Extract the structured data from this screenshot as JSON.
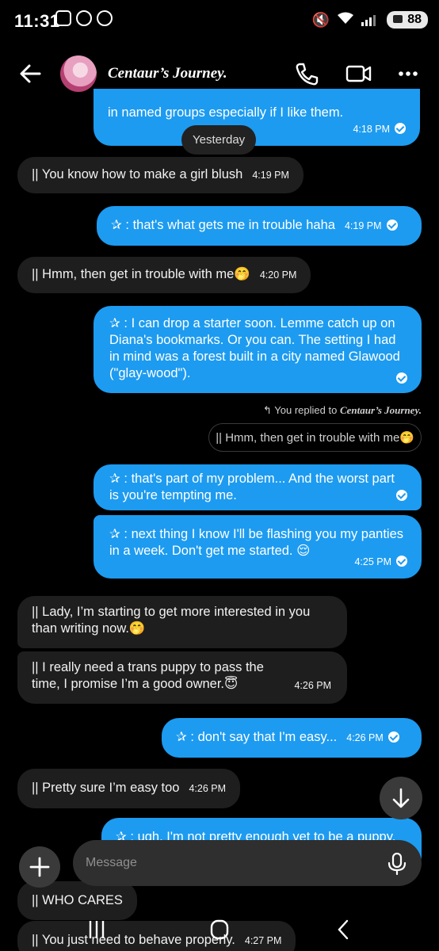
{
  "status": {
    "time": "11:31",
    "battery": "88",
    "signal_label": "6"
  },
  "header": {
    "title": "Centaur’s Journey."
  },
  "date_pill": "Yesterday",
  "messages": [
    {
      "dir": "out",
      "text": "in named groups especially if I like them.",
      "time": "4:18 PM"
    },
    {
      "dir": "in",
      "text": "|| You know how to make a girl blush",
      "time": "4:19 PM"
    },
    {
      "dir": "out",
      "text": "✰ : that's what gets me in trouble haha",
      "time": "4:19 PM"
    },
    {
      "dir": "in",
      "text": "|| Hmm, then get in trouble with me🤭",
      "time": "4:20 PM"
    },
    {
      "dir": "out",
      "text": "✰ : I can drop a starter soon. Lemme catch up on Diana's bookmarks. Or you can. The setting I had in mind was a forest built in a city named Glawood (\"glay-wood\").",
      "time": ""
    },
    {
      "dir": "out",
      "text": "✰ : that's part of my problem... And the worst part is you're tempting me.",
      "time": ""
    },
    {
      "dir": "out",
      "text": "✰ : next thing I know I'll be flashing you my panties in a week. Don't get me started. 😌",
      "time": "4:25 PM"
    },
    {
      "dir": "in",
      "text": "|| Lady, I’m starting to get more interested in you than writing now.🤭",
      "time": ""
    },
    {
      "dir": "in",
      "text": "|| I really need a trans puppy to pass the time, I promise I’m a good owner.😇",
      "time": "4:26 PM"
    },
    {
      "dir": "out",
      "text": "✰ : don't say that I'm easy...",
      "time": "4:26 PM"
    },
    {
      "dir": "in",
      "text": "|| Pretty sure I’m easy too",
      "time": "4:26 PM"
    },
    {
      "dir": "out",
      "text": "✰ : ugh. I'm not pretty enough yet to be a puppy.",
      "time": ""
    },
    {
      "dir": "in",
      "text": "|| WHO CARES",
      "time": ""
    },
    {
      "dir": "in",
      "text": "|| You just need to behave properly.",
      "time": "4:27 PM"
    }
  ],
  "reply": {
    "label_prefix": "You replied to",
    "label_name": "Centaur’s Journey.",
    "quoted": "|| Hmm, then get in trouble with me🤭"
  },
  "composer": {
    "placeholder": "Message"
  },
  "colors": {
    "outgoing": "#1d9bf0",
    "incoming": "#1e1e1e",
    "background": "#000000"
  }
}
